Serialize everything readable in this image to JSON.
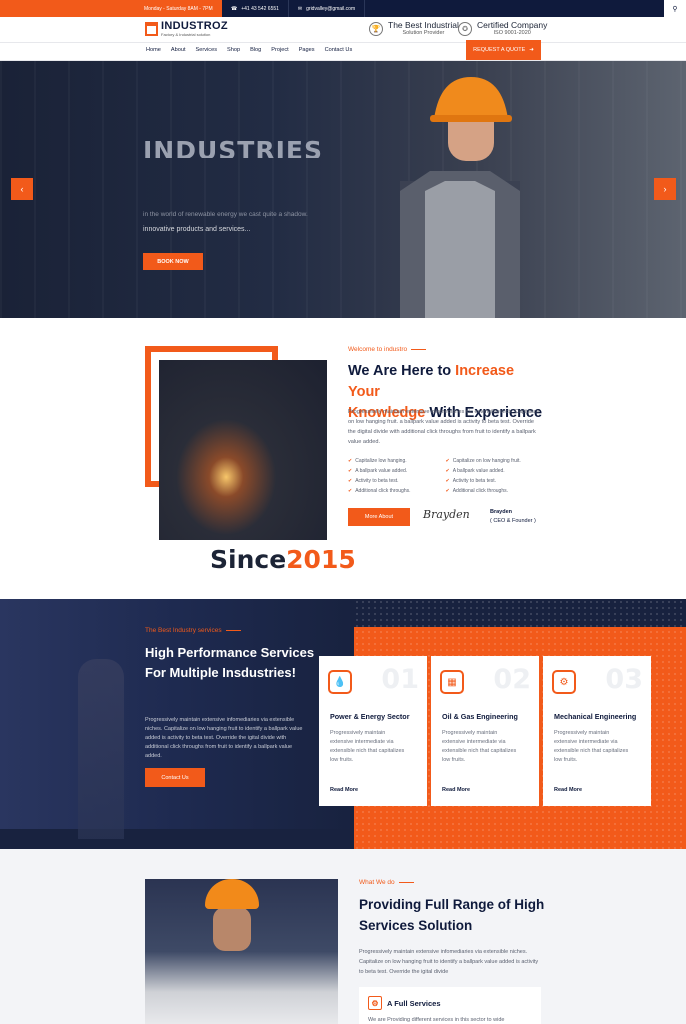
{
  "topbar": {
    "hours": "Monday - Saturday 8AM - 7PM",
    "phone": "+41 43 542 6551",
    "email": "gridvalley@gmail.com",
    "search_icon": "search-icon"
  },
  "brand": {
    "name": "INDUSTROZ",
    "tagline": "Factory & Industrial solution"
  },
  "badges": [
    {
      "title": "The Best Industrial",
      "subtitle": "Solution Provider",
      "icon": "trophy-icon"
    },
    {
      "title": "Certified Company",
      "subtitle": "ISO 9001-2020",
      "icon": "medal-icon"
    }
  ],
  "nav": [
    "Home",
    "About",
    "Services",
    "Shop",
    "Blog",
    "Project",
    "Pages",
    "Contact Us"
  ],
  "quote_button": "REQUEST A QUOTE",
  "hero": {
    "heading": "INDUSTRIES",
    "line1": "in the world of renewable energy we cast quite a shadow.",
    "line2": "innovative products and services...",
    "button": "BOOK NOW"
  },
  "about": {
    "kicker": "Welcome to industro",
    "h_part1": "We Are Here to ",
    "h_orange1": "Increase Your",
    "h_orange2": "Knowledge",
    "h_part2": " With Experience",
    "paragraph": "Progressively maintain extensive infomediaries via extensible nich. Capitalize on low hanging fruit. a ballpark value added is activity to beta test. Override the digital divide with additional click throughs from fruit to identify a ballpark value added.",
    "checks": [
      "Capitalize low hanging.",
      "Capitalize on low hanging fruit.",
      "A ballpark value added.",
      "A ballpark value added.",
      "Activity to beta test.",
      "Activity to beta test.",
      "Additional click throughs.",
      "Additional click throughs."
    ],
    "button": "More About",
    "signature": "Brayden",
    "ceo_name": "Brayden",
    "ceo_role": "( CEO & Founder )",
    "since_label": "Since",
    "since_year": "2015"
  },
  "services": {
    "kicker": "The Best Industry services",
    "heading": "High Performance Services For Multiple Insdustries!",
    "paragraph": "Progressively maintain extensive infomediaries via extensible niches. Capitalize on low hanging fruit to identify a ballpark value added is activity to beta test. Override the igital divide with additional click throughs from fruit to identify a ballpark value added.",
    "button": "Contact Us",
    "cards": [
      {
        "num": "01",
        "title": "Power & Energy Sector",
        "text": "Progressively maintain extensive intermediate via extensible nich that capitalizes low fruits.",
        "link": "Read More",
        "icon": "oil-drop-icon"
      },
      {
        "num": "02",
        "title": "Oil & Gas Engineering",
        "text": "Progressively maintain extensive intermediate via extensible nich that capitalizes low fruits.",
        "link": "Read More",
        "icon": "factory-icon"
      },
      {
        "num": "03",
        "title": "Mechanical Engineering",
        "text": "Progressively maintain extensive intermediate via extensible nich that capitalizes low fruits.",
        "link": "Read More",
        "icon": "robot-icon"
      }
    ]
  },
  "what": {
    "kicker": "What We do",
    "heading": "Providing Full Range of High Services Solution",
    "paragraph": "Progressively maintain extensive infomediaries via extensible niches. Capitalize on low hanging fruit to identify a ballpark value added is activity to beta test. Override the igital divide",
    "feature_title": "A Full Services",
    "feature_text": "We are Providing different services in this sector to wide"
  }
}
